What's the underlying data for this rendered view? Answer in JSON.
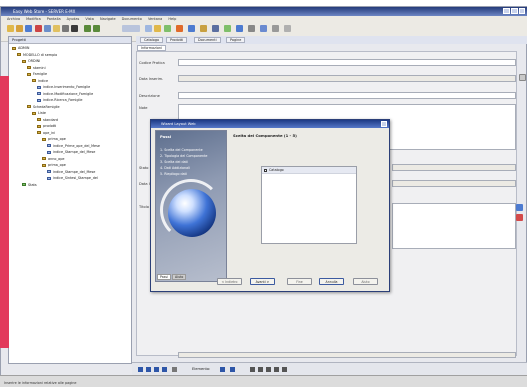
{
  "window": {
    "title": "Easy Web Store - SERVER E-MX"
  },
  "menubar": [
    "Archivo",
    "Modifica",
    "Pantalla",
    "Ayudas",
    "Vista",
    "Navigate",
    "Documento",
    "Ventana",
    "Help"
  ],
  "left_panel": {
    "title": "Progetti",
    "tree": [
      {
        "label": "ADMIN",
        "indent": 0,
        "icon": "folder"
      },
      {
        "label": "MODELLO di sempio",
        "indent": 1,
        "icon": "folder"
      },
      {
        "label": "ORDINI",
        "indent": 2,
        "icon": "folder"
      },
      {
        "label": "stamini",
        "indent": 3,
        "icon": "folder"
      },
      {
        "label": "Famiglie",
        "indent": 3,
        "icon": "folder"
      },
      {
        "label": "indice",
        "indent": 4,
        "icon": "folder"
      },
      {
        "label": "indice.Inserimento_Famiglie",
        "indent": 5,
        "icon": "page"
      },
      {
        "label": "indice.Modificazione_Famiglie",
        "indent": 5,
        "icon": "page"
      },
      {
        "label": "indice.Ricerca_Famiglie",
        "indent": 5,
        "icon": "page"
      },
      {
        "label": "SchedaFamiglie",
        "indent": 3,
        "icon": "folder"
      },
      {
        "label": "Liste",
        "indent": 4,
        "icon": "folder"
      },
      {
        "label": "standard",
        "indent": 5,
        "icon": "folder"
      },
      {
        "label": "prodotti",
        "indent": 5,
        "icon": "folder"
      },
      {
        "label": "ope_ini",
        "indent": 5,
        "icon": "folder"
      },
      {
        "label": "prima_ope",
        "indent": 6,
        "icon": "folder"
      },
      {
        "label": "indice_Prime_ope_del_Mese",
        "indent": 7,
        "icon": "page"
      },
      {
        "label": "indice_Stampe_del_Mese",
        "indent": 7,
        "icon": "page"
      },
      {
        "label": "anno_ope",
        "indent": 6,
        "icon": "folder"
      },
      {
        "label": "prima_ope",
        "indent": 6,
        "icon": "folder"
      },
      {
        "label": "indice_Stampe_del_Mese",
        "indent": 7,
        "icon": "page"
      },
      {
        "label": "indice_Sintesi_Stampe_del",
        "indent": 7,
        "icon": "page"
      },
      {
        "label": "Stats",
        "indent": 2,
        "icon": "green"
      }
    ]
  },
  "tabs": [
    "Catalogo",
    "Prodotti",
    "Documenti",
    "Pagine"
  ],
  "subtab": "Informazioni",
  "form": {
    "labels": [
      "Codice Pratica",
      "Data Inserim.",
      "Descrizione",
      "Note",
      "Stato",
      "Data Inizio",
      "Titolo"
    ]
  },
  "dialog": {
    "title": "Wizard Layout Web",
    "side_title": "Passi",
    "steps": [
      "Scelta del Componente",
      "Tipologia del Componente",
      "Scelta dei dati",
      "Dati Addizionali",
      "Riepilogo dati"
    ],
    "side_tabs": [
      "Passi",
      "Aiuto"
    ],
    "main_title": "Scelta del Componente (1 - 5)",
    "list_items": [
      "Catalogo"
    ],
    "buttons": [
      "< Indietro",
      "Avanti >",
      "Fine",
      "Annulla",
      "Aiuto"
    ]
  },
  "bottom_nav": {
    "label": "Elemento:"
  },
  "status": "Inserire le informazioni relative alle pagine"
}
